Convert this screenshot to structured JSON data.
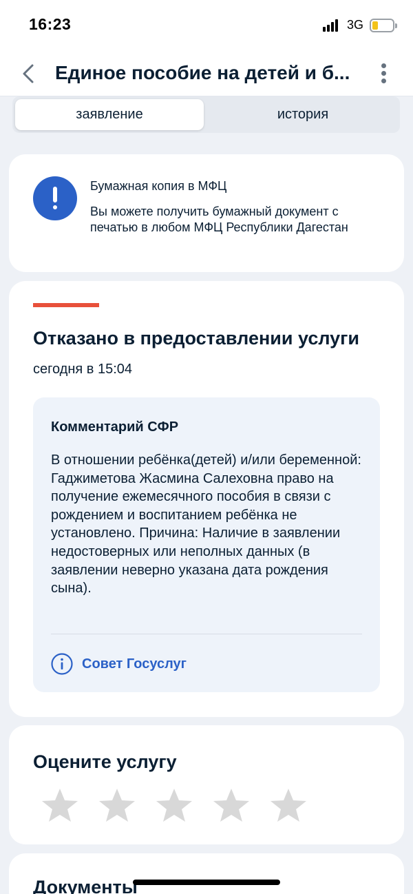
{
  "status_bar": {
    "time": "16:23",
    "network": "3G",
    "battery_level": 0.2
  },
  "header": {
    "title": "Единое пособие на детей и б...",
    "back_icon": "chevron-left-icon",
    "menu_icon": "more-vertical-icon"
  },
  "tabs": [
    {
      "label": "заявление",
      "active": true
    },
    {
      "label": "история",
      "active": false
    }
  ],
  "info_card": {
    "icon": "exclamation-icon",
    "title": "Бумажная копия в МФЦ",
    "text": "Вы можете получить бумажный документ с печатью в любом МФЦ Республики Дагестан"
  },
  "status_card": {
    "title": "Отказано в предоставлении услуги",
    "time": "сегодня в 15:04",
    "status_color": "#e8503a",
    "comment": {
      "title": "Комментарий СФР",
      "text": "В отношении ребёнка(детей) и/или беременной: Гаджиметова Жасмина Салеховна право на получение ежемесячного пособия в связи с рождением и воспитанием ребёнка не установлено. Причина: Наличие в заявлении недостоверных или неполных данных (в заявлении неверно указана дата рождения сына).",
      "tip_label": "Совет Госуслуг",
      "tip_icon": "info-icon"
    }
  },
  "rating": {
    "title": "Оцените услугу",
    "max_stars": 5,
    "selected": 0,
    "star_color": "#d8d8d8"
  },
  "documents": {
    "title": "Документы"
  },
  "colors": {
    "accent": "#2b61c7",
    "background": "#eef1f6",
    "text": "#0b1f33"
  }
}
